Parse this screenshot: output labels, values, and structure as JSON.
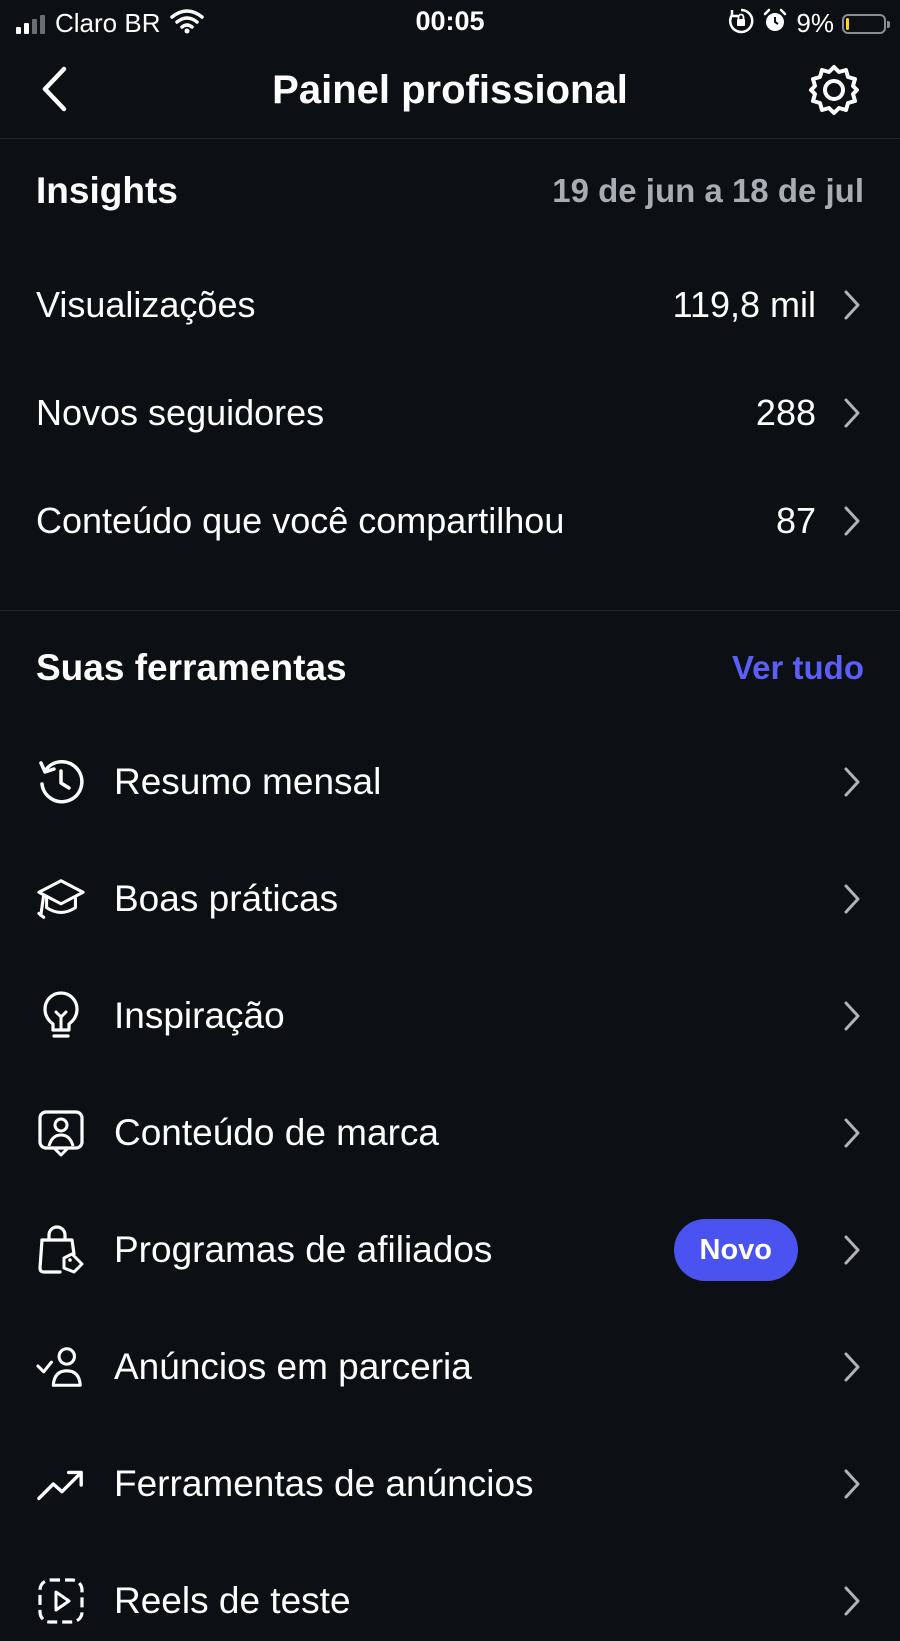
{
  "status_bar": {
    "carrier": "Claro BR",
    "time": "00:05",
    "battery_percent": "9%",
    "battery_level": 0.09
  },
  "nav": {
    "title": "Painel profissional",
    "back_icon": "chevron-left-icon",
    "settings_icon": "gear-icon"
  },
  "insights": {
    "title": "Insights",
    "date_range": "19 de jun a 18 de jul",
    "rows": [
      {
        "label": "Visualizações",
        "value": "119,8 mil"
      },
      {
        "label": "Novos seguidores",
        "value": "288"
      },
      {
        "label": "Conteúdo que você compartilhou",
        "value": "87"
      }
    ]
  },
  "tools": {
    "title": "Suas ferramentas",
    "see_all": "Ver tudo",
    "items": [
      {
        "label": "Resumo mensal",
        "icon": "history-icon"
      },
      {
        "label": "Boas práticas",
        "icon": "graduation-cap-icon"
      },
      {
        "label": "Inspiração",
        "icon": "lightbulb-icon"
      },
      {
        "label": "Conteúdo de marca",
        "icon": "branded-content-icon"
      },
      {
        "label": "Programas de afiliados",
        "icon": "shopping-bag-icon",
        "badge": "Novo"
      },
      {
        "label": "Anúncios em parceria",
        "icon": "person-check-icon"
      },
      {
        "label": "Ferramentas de anúncios",
        "icon": "trending-up-icon"
      },
      {
        "label": "Reels de teste",
        "icon": "reels-icon"
      }
    ]
  },
  "colors": {
    "background": "#0c1014",
    "accent": "#5b5ef7",
    "badge": "#4a52f0",
    "muted_text": "#a8acb3"
  }
}
